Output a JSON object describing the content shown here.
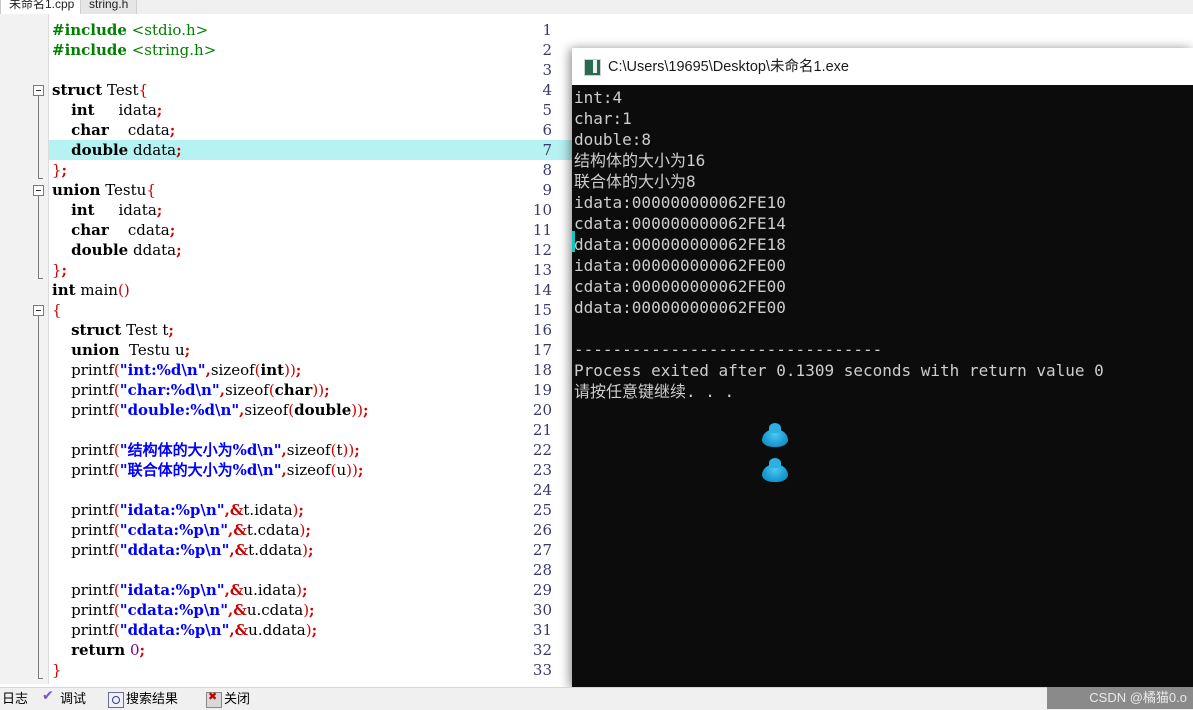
{
  "tabs": [
    {
      "label": "未命名1.cpp",
      "active": true
    },
    {
      "label": "string.h",
      "active": false
    }
  ],
  "editor": {
    "highlighted_line": 7,
    "lines": [
      {
        "n": 1,
        "text": "#include <stdio.h>"
      },
      {
        "n": 2,
        "text": "#include <string.h>"
      },
      {
        "n": 3,
        "text": ""
      },
      {
        "n": 4,
        "text": "struct Test{"
      },
      {
        "n": 5,
        "text": "    int     idata;"
      },
      {
        "n": 6,
        "text": "    char    cdata;"
      },
      {
        "n": 7,
        "text": "    double ddata;"
      },
      {
        "n": 8,
        "text": "};"
      },
      {
        "n": 9,
        "text": "union Testu{"
      },
      {
        "n": 10,
        "text": "    int     idata;"
      },
      {
        "n": 11,
        "text": "    char    cdata;"
      },
      {
        "n": 12,
        "text": "    double ddata;"
      },
      {
        "n": 13,
        "text": "};"
      },
      {
        "n": 14,
        "text": "int main()"
      },
      {
        "n": 15,
        "text": "{"
      },
      {
        "n": 16,
        "text": "    struct Test t;"
      },
      {
        "n": 17,
        "text": "    union  Testu u;"
      },
      {
        "n": 18,
        "text": "    printf(\"int:%d\\n\",sizeof(int));"
      },
      {
        "n": 19,
        "text": "    printf(\"char:%d\\n\",sizeof(char));"
      },
      {
        "n": 20,
        "text": "    printf(\"double:%d\\n\",sizeof(double));"
      },
      {
        "n": 21,
        "text": ""
      },
      {
        "n": 22,
        "text": "    printf(\"结构体的大小为%d\\n\",sizeof(t));"
      },
      {
        "n": 23,
        "text": "    printf(\"联合体的大小为%d\\n\",sizeof(u));"
      },
      {
        "n": 24,
        "text": ""
      },
      {
        "n": 25,
        "text": "    printf(\"idata:%p\\n\",&t.idata);"
      },
      {
        "n": 26,
        "text": "    printf(\"cdata:%p\\n\",&t.cdata);"
      },
      {
        "n": 27,
        "text": "    printf(\"ddata:%p\\n\",&t.ddata);"
      },
      {
        "n": 28,
        "text": ""
      },
      {
        "n": 29,
        "text": "    printf(\"idata:%p\\n\",&u.idata);"
      },
      {
        "n": 30,
        "text": "    printf(\"cdata:%p\\n\",&u.cdata);"
      },
      {
        "n": 31,
        "text": "    printf(\"ddata:%p\\n\",&u.ddata);"
      },
      {
        "n": 32,
        "text": "    return 0;"
      },
      {
        "n": 33,
        "text": "}"
      }
    ]
  },
  "console": {
    "title": "C:\\Users\\19695\\Desktop\\未命名1.exe",
    "icon": "console-app-icon",
    "output": [
      "int:4",
      "char:1",
      "double:8",
      "结构体的大小为16",
      "联合体的大小为8",
      "idata:000000000062FE10",
      "cdata:000000000062FE14",
      "ddata:000000000062FE18",
      "idata:000000000062FE00",
      "cdata:000000000062FE00",
      "ddata:000000000062FE00",
      "",
      "--------------------------------",
      "Process exited after 0.1309 seconds with return value 0",
      "请按任意键继续. . ."
    ]
  },
  "bottom_bar": {
    "items": [
      {
        "label": "日志",
        "icon": null
      },
      {
        "label": "调试",
        "icon": "check-icon"
      },
      {
        "label": "搜索结果",
        "icon": "magnifier-icon"
      },
      {
        "label": "关闭",
        "icon": "close-icon"
      }
    ]
  },
  "watermark": "CSDN @橘猫0.o",
  "colors": {
    "keyword": "#000000",
    "preprocessor": "#008000",
    "string": "#0000ff",
    "punctuation": "#cc0000",
    "number": "#800080",
    "highlight_row": "#b6f2f2",
    "console_bg": "#0c0c0c",
    "console_fg": "#cdcdcd",
    "cursor_teal": "#12c4c4"
  }
}
